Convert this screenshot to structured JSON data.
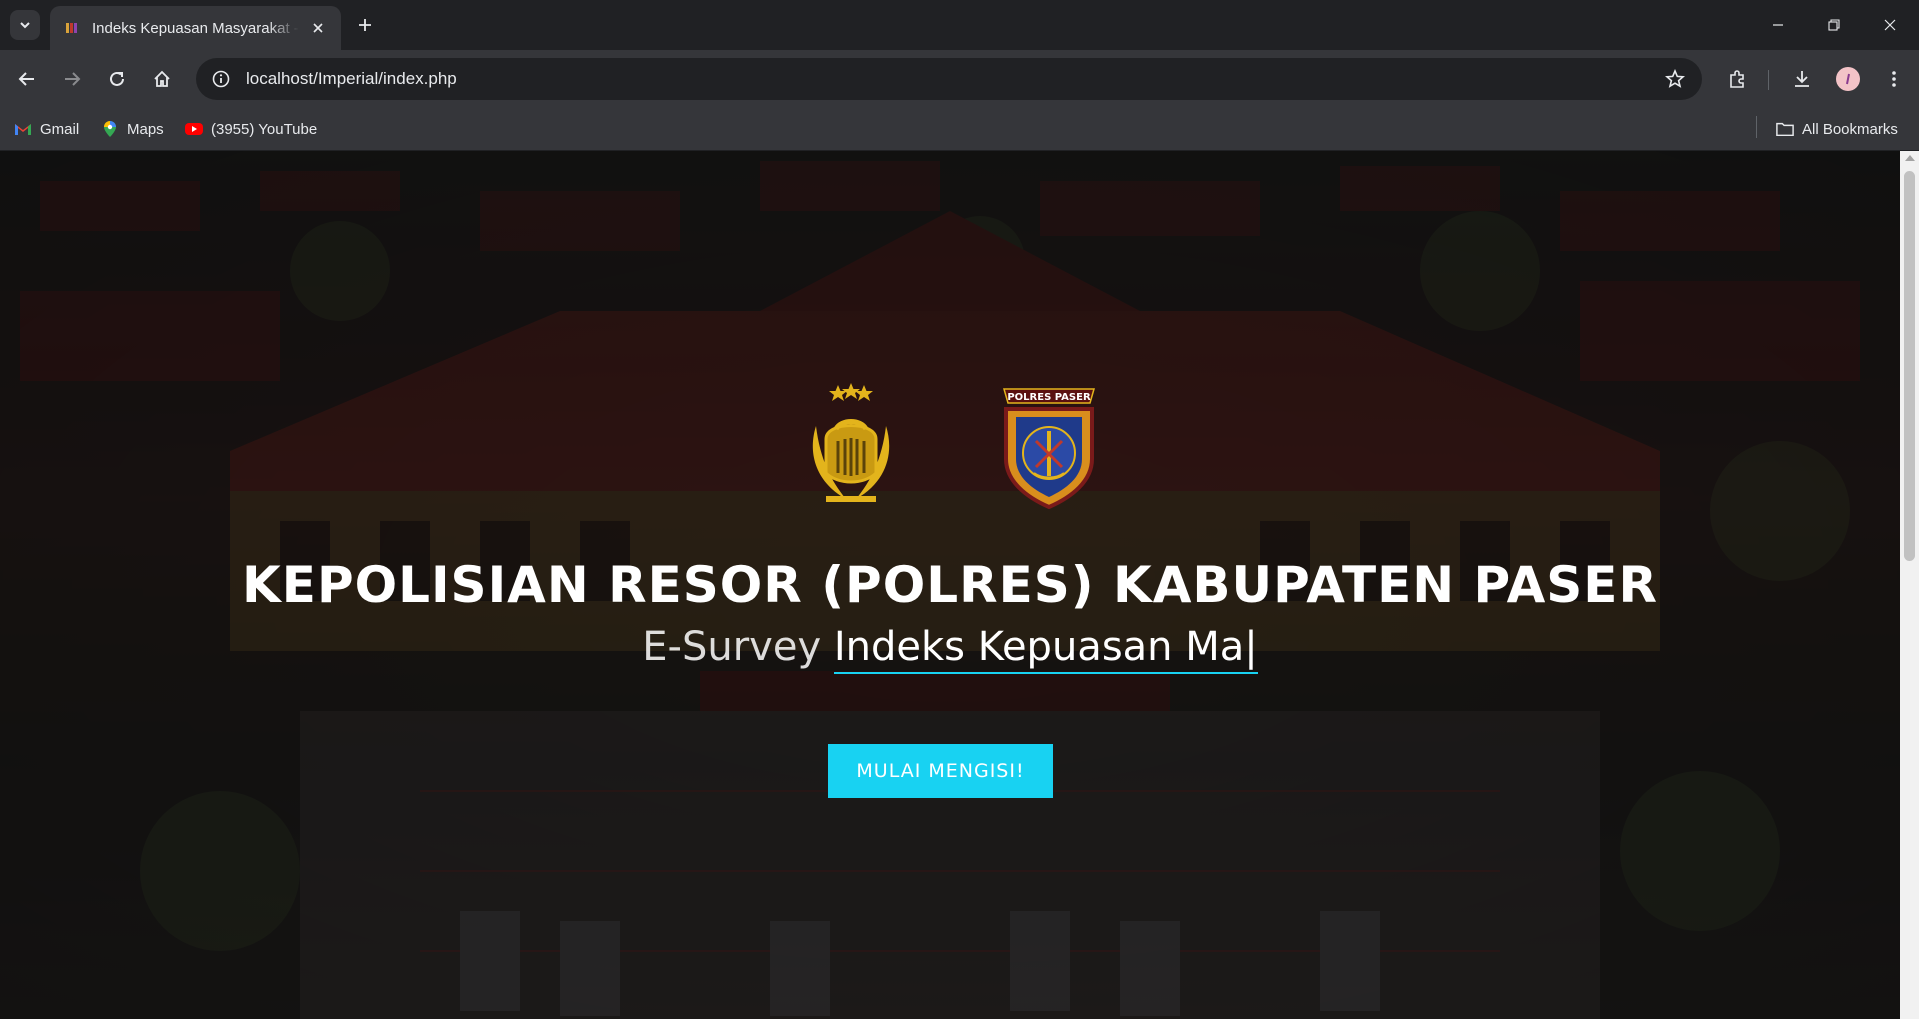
{
  "browser": {
    "tab_title": "Indeks Kepuasan Masyarakat - Polres Paser",
    "url": "localhost/Imperial/index.php",
    "bookmarks": [
      {
        "label": "Gmail",
        "icon": "gmail-icon"
      },
      {
        "label": "Maps",
        "icon": "maps-icon"
      },
      {
        "label": "(3955) YouTube",
        "icon": "youtube-icon"
      }
    ],
    "all_bookmarks_label": "All Bookmarks"
  },
  "hero": {
    "logos": [
      "police-emblem-icon",
      "polres-paser-badge-icon"
    ],
    "badge_text": "POLRES PASER",
    "headline": "KEPOLISIAN RESOR (POLRES) KABUPATEN PASER",
    "sub_prefix": "E-Survey",
    "sub_typed": "Indeks Kepuasan Ma|",
    "cta_label": "MULAI MENGISI!"
  },
  "colors": {
    "accent": "#18d2f2",
    "chrome_dark": "#202124",
    "chrome_mid": "#35363a"
  }
}
